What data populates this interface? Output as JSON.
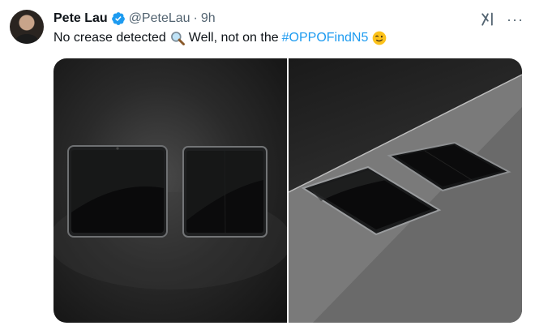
{
  "post": {
    "author_name": "Pete Lau",
    "handle": "@PeteLau",
    "separator": "·",
    "time": "9h",
    "text_part1": "No crease detected",
    "text_part2": "Well, not on the",
    "hashtag": "#OPPOFindN5",
    "more_label": "···"
  },
  "icons": {
    "verified": "verified-badge-icon",
    "grok": "grok-icon",
    "more": "more-icon",
    "magnifier": "magnifying-glass-emoji",
    "wink": "winking-face-emoji"
  },
  "colors": {
    "text": "#0f1419",
    "secondary": "#536471",
    "link": "#1d9bf0"
  },
  "media": {
    "count": 2,
    "images": [
      "two-folded-phones-front-view",
      "two-phones-on-table-angled-view"
    ]
  }
}
